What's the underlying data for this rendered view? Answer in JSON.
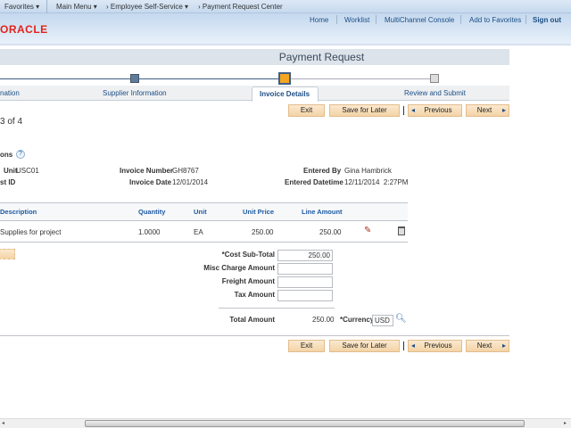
{
  "topnav": {
    "favorites": "Favorites",
    "main_menu": "Main Menu",
    "ess": "Employee Self-Service",
    "current": "Payment Request Center"
  },
  "header": {
    "links": [
      "Home",
      "Worklist",
      "MultiChannel Console",
      "Add to Favorites"
    ],
    "signout": "Sign out",
    "logo": "ORACLE"
  },
  "page_title": "Payment Request",
  "steps": [
    {
      "label": "nation",
      "state": "done"
    },
    {
      "label": "Supplier Information",
      "state": "done"
    },
    {
      "label": "Invoice Details",
      "state": "current"
    },
    {
      "label": "Review and Submit",
      "state": "pending"
    }
  ],
  "buttons": {
    "exit": "Exit",
    "save": "Save for Later",
    "previous": "Previous",
    "next": "Next"
  },
  "step_count": "3 of 4",
  "section": {
    "title": "ons"
  },
  "fields": {
    "unit_label": "Unit",
    "unit_value": "USC01",
    "id_label": "st ID",
    "invoice_number_label": "Invoice Number",
    "invoice_number": "GH8767",
    "invoice_date_label": "Invoice Date",
    "invoice_date": "12/01/2014",
    "entered_by_label": "Entered By",
    "entered_by": "Gina Hambrick",
    "entered_dt_label": "Entered Datetime",
    "entered_dt": "12/11/2014  2:27PM"
  },
  "table": {
    "headers": [
      "Description",
      "Quantity",
      "Unit",
      "Unit Price",
      "Line Amount"
    ],
    "rows": [
      {
        "description": "Supplies for project",
        "quantity": "1.0000",
        "unit": "EA",
        "unit_price": "250.00",
        "line_amount": "250.00"
      }
    ]
  },
  "totals": {
    "cost_label": "*Cost Sub-Total",
    "cost": "250.00",
    "misc_label": "Misc Charge Amount",
    "misc": "",
    "freight_label": "Freight Amount",
    "freight": "",
    "tax_label": "Tax Amount",
    "tax": "",
    "total_label": "Total Amount",
    "total": "250.00",
    "currency_label": "*Currency",
    "currency": "USD"
  },
  "colors": {
    "accent": "#1d4e86",
    "button": "#f3d3a6",
    "oracle": "#e2231a",
    "current_step": "#f5a623"
  }
}
